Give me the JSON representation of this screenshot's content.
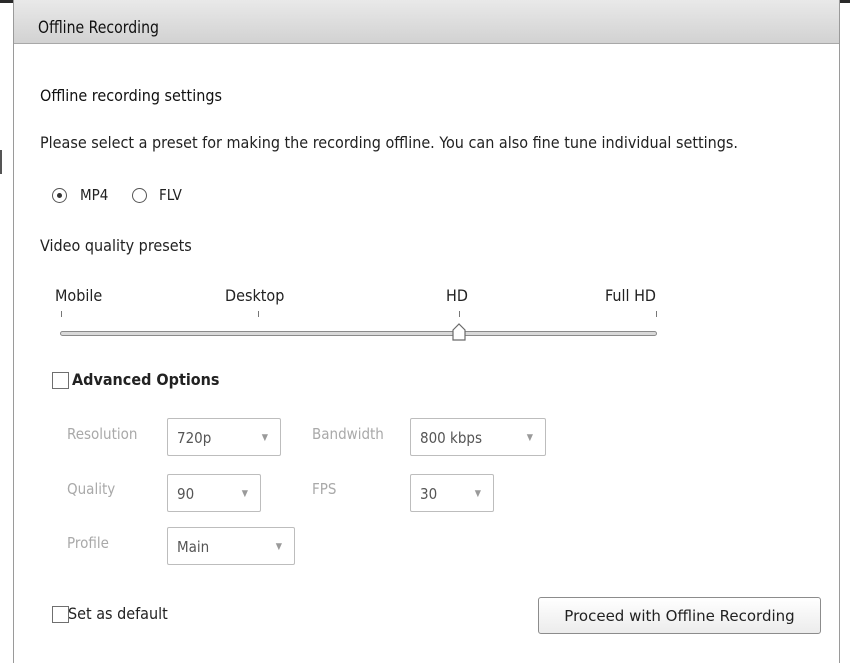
{
  "window": {
    "title": "Offline Recording"
  },
  "settings": {
    "heading": "Offline recording settings",
    "description": "Please select a preset for making the recording offline. You can also fine tune individual settings.",
    "format_options": [
      {
        "label": "MP4",
        "checked": true
      },
      {
        "label": "FLV",
        "checked": false
      }
    ]
  },
  "presets": {
    "label": "Video quality presets",
    "stops": [
      "Mobile",
      "Desktop",
      "HD",
      "Full HD"
    ],
    "selected": "HD"
  },
  "advanced": {
    "label": "Advanced Options",
    "checked": false,
    "fields": {
      "resolution": {
        "label": "Resolution",
        "value": "720p"
      },
      "bandwidth": {
        "label": "Bandwidth",
        "value": "800 kbps"
      },
      "quality": {
        "label": "Quality",
        "value": "90"
      },
      "fps": {
        "label": "FPS",
        "value": "30"
      },
      "profile": {
        "label": "Profile",
        "value": "Main"
      }
    }
  },
  "footer": {
    "set_default_label": "Set as default",
    "set_default_checked": false,
    "proceed_label": "Proceed with Offline Recording"
  },
  "icons": {
    "dropdown": "chevron-down-icon",
    "slider_thumb": "slider-thumb-icon"
  },
  "colors": {
    "titlebar": "#dcdcdc",
    "disabled_text": "#a9a9a9",
    "border": "#9a9a9a"
  }
}
